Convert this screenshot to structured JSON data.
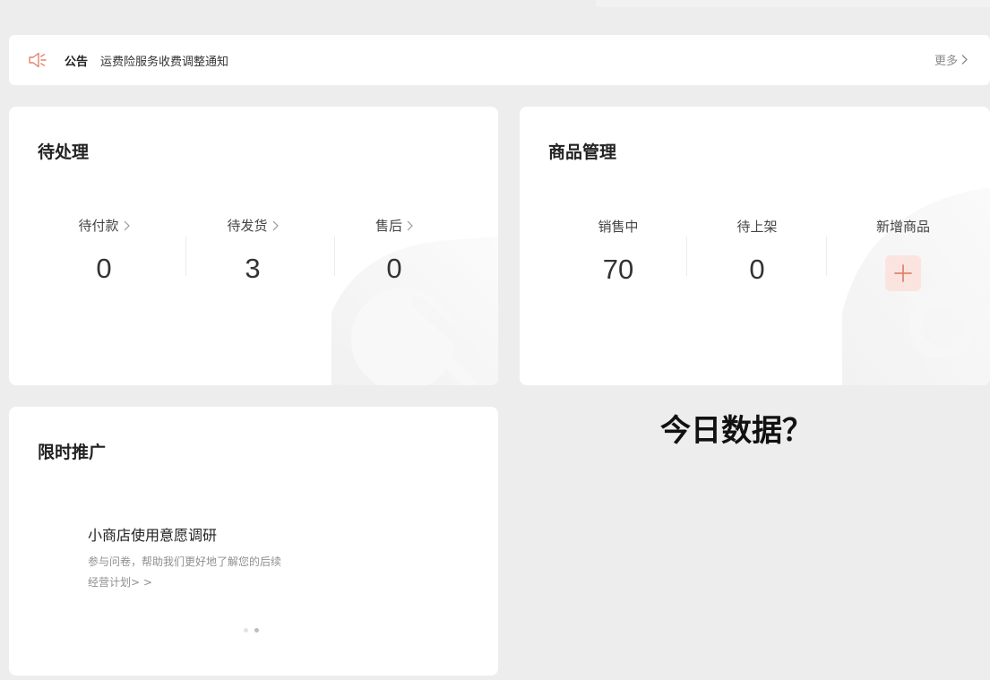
{
  "notice": {
    "tag": "公告",
    "message": "运费险服务收费调整通知",
    "more": "更多"
  },
  "pending": {
    "title": "待处理",
    "items": [
      {
        "label": "待付款",
        "value": "0"
      },
      {
        "label": "待发货",
        "value": "3"
      },
      {
        "label": "售后",
        "value": "0"
      }
    ]
  },
  "goods": {
    "title": "商品管理",
    "items": [
      {
        "label": "销售中",
        "value": "70"
      },
      {
        "label": "待上架",
        "value": "0"
      }
    ],
    "add_label": "新增商品"
  },
  "promo": {
    "title": "限时推广",
    "item_title": "小商店使用意愿调研",
    "item_desc": "参与问卷，帮助我们更好地了解您的后续经营计划> >",
    "dot_count": 2,
    "active_dot": 2
  },
  "today": {
    "question": "今日数据？"
  },
  "colors": {
    "accent": "#e0846b",
    "accent_bg": "#fbe4df",
    "page_bg": "#ededed"
  },
  "icons": [
    "speaker-icon",
    "chevron-right-icon",
    "plus-icon"
  ]
}
